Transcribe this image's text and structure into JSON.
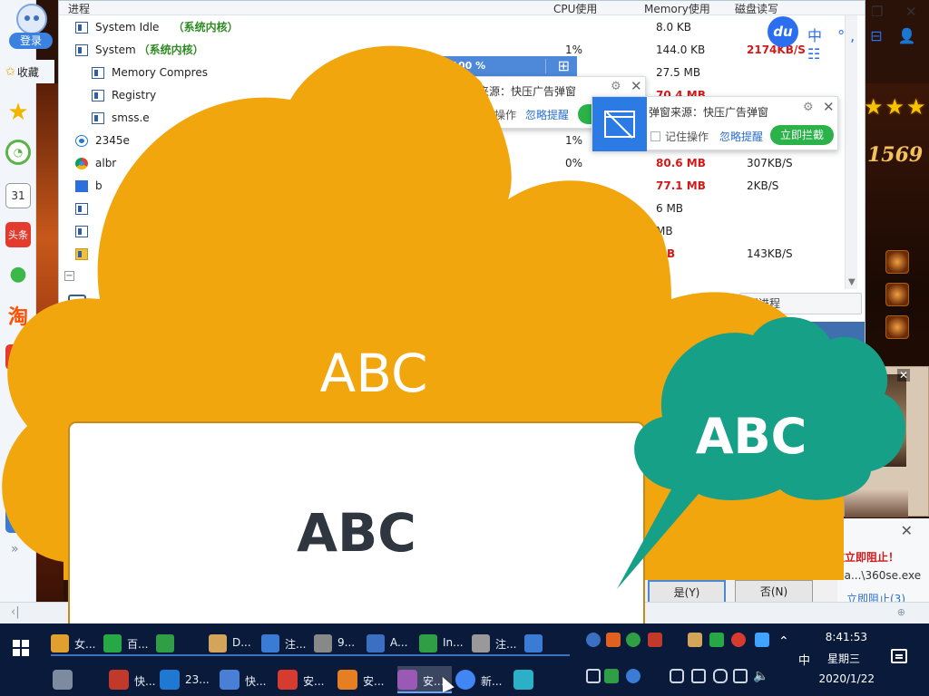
{
  "sidebar": {
    "login_label": "登录",
    "favorites_label": "收藏",
    "more_label": "»",
    "items": [
      {
        "icon": "star-icon",
        "color": "#f3b400"
      },
      {
        "icon": "clock-icon",
        "color": "#5bb34a"
      },
      {
        "icon": "calendar-icon",
        "label": "31",
        "color": "#ffffff"
      },
      {
        "icon": "toutiao-icon",
        "label": "头条",
        "color": "#e33b2e"
      },
      {
        "icon": "wechat-icon",
        "color": "#3cb84a"
      },
      {
        "icon": "taobao-icon",
        "label": "淘",
        "color": "#ff5000"
      },
      {
        "icon": "game-icon",
        "label": "5",
        "color": "#e33b2e"
      },
      {
        "icon": "calculator-icon",
        "color": "#3a7bd5"
      }
    ]
  },
  "task_manager": {
    "columns": {
      "process": "进程",
      "cpu": "CPU使用",
      "memory": "Memory使用",
      "disk": "磁盘读写"
    },
    "rows": [
      {
        "name": "System Idle",
        "suffix": "（系统内核）",
        "cpu": "",
        "mem": "8.0 KB",
        "mem_red": false,
        "disk": "",
        "indent": 0,
        "icon": "window-icon"
      },
      {
        "name": "System",
        "suffix": "（系统内核）",
        "cpu": "1%",
        "mem": "144.0 KB",
        "mem_red": false,
        "disk": "2174KB/S",
        "disk_red": true,
        "indent": 0,
        "icon": "window-icon"
      },
      {
        "name": "Memory Compres",
        "suffix": "",
        "cpu": "",
        "mem": "27.5 MB",
        "mem_red": false,
        "disk": "",
        "indent": 1,
        "icon": "window-icon"
      },
      {
        "name": "Registry",
        "suffix": "",
        "cpu": "",
        "mem": "70.4 MB",
        "mem_red": true,
        "disk": "",
        "indent": 1,
        "icon": "window-icon"
      },
      {
        "name": "smss.e",
        "suffix": "",
        "cpu": "",
        "mem": "",
        "mem_red": false,
        "disk": "",
        "indent": 1,
        "icon": "window-icon"
      },
      {
        "name": "2345e",
        "suffix": "",
        "cpu": "1%",
        "mem": "",
        "mem_red": false,
        "disk": "",
        "indent": 0,
        "icon": "ie-icon"
      },
      {
        "name": "albr",
        "suffix": "",
        "cpu": "0%",
        "mem": "80.6 MB",
        "mem_red": true,
        "disk": "307KB/S",
        "indent": 0,
        "icon": "chrome-icon"
      },
      {
        "name": "b",
        "suffix": "",
        "cpu": "",
        "mem": "77.1 MB",
        "mem_red": true,
        "disk": "2KB/S",
        "indent": 0,
        "icon": "baidu-icon"
      },
      {
        "name": "",
        "suffix": "",
        "cpu": "",
        "mem": "6 MB",
        "mem_red": false,
        "disk": "",
        "indent": 0,
        "icon": "window-icon"
      },
      {
        "name": "",
        "suffix": "",
        "cpu": "",
        "mem": "MB",
        "mem_red": false,
        "disk": "",
        "indent": 0,
        "icon": "window-icon"
      },
      {
        "name": "",
        "suffix": "",
        "cpu": "",
        "mem": "MB",
        "mem_red": true,
        "disk": "143KB/S",
        "indent": 0,
        "icon": "folder-icon"
      },
      {
        "name": "",
        "suffix": "",
        "cpu": "",
        "mem": "B",
        "mem_red": true,
        "disk": "",
        "indent": 0,
        "icon": ""
      }
    ],
    "process_button": "词进程",
    "bottom_link": "book"
  },
  "cpu_bar": {
    "label": "CPU: 100 %"
  },
  "ime_bar": {
    "logo": "du",
    "text": "中 °, ⊟ 👤 ☷"
  },
  "popups": {
    "back": {
      "source": "弹窗来源：快压广告弹窗",
      "remember": "记住操作",
      "ignore": "忽略提醒"
    },
    "front": {
      "source": "弹窗来源：快压广告弹窗",
      "remember": "记住操作",
      "ignore": "忽略提醒",
      "block": "立即拦截"
    }
  },
  "game": {
    "score": "1569"
  },
  "warning": {
    "title": "改立即阻止！",
    "path": "da...\\360se.exe",
    "action": "立即阻止(3)"
  },
  "dialog": {
    "yes": "是(Y)",
    "no": "否(N)"
  },
  "overlay": {
    "cloud_text": "ABC",
    "card_text": "ABC",
    "bubble_text": "ABC",
    "cloud_color": "#f2a60d",
    "card_border": "#c8891b",
    "bubble_color": "#16a087"
  },
  "taskbar": {
    "row1": [
      "女...",
      "百...",
      "",
      "D...",
      "注...",
      "9...",
      "A...",
      "In...",
      "注...",
      ""
    ],
    "row2": [
      "快...",
      "23...",
      "快...",
      "安...",
      "安...",
      "安...",
      "新...",
      ""
    ],
    "time": "8:41:53",
    "weekday": "星期三",
    "date": "2020/1/22",
    "ime": "中"
  }
}
